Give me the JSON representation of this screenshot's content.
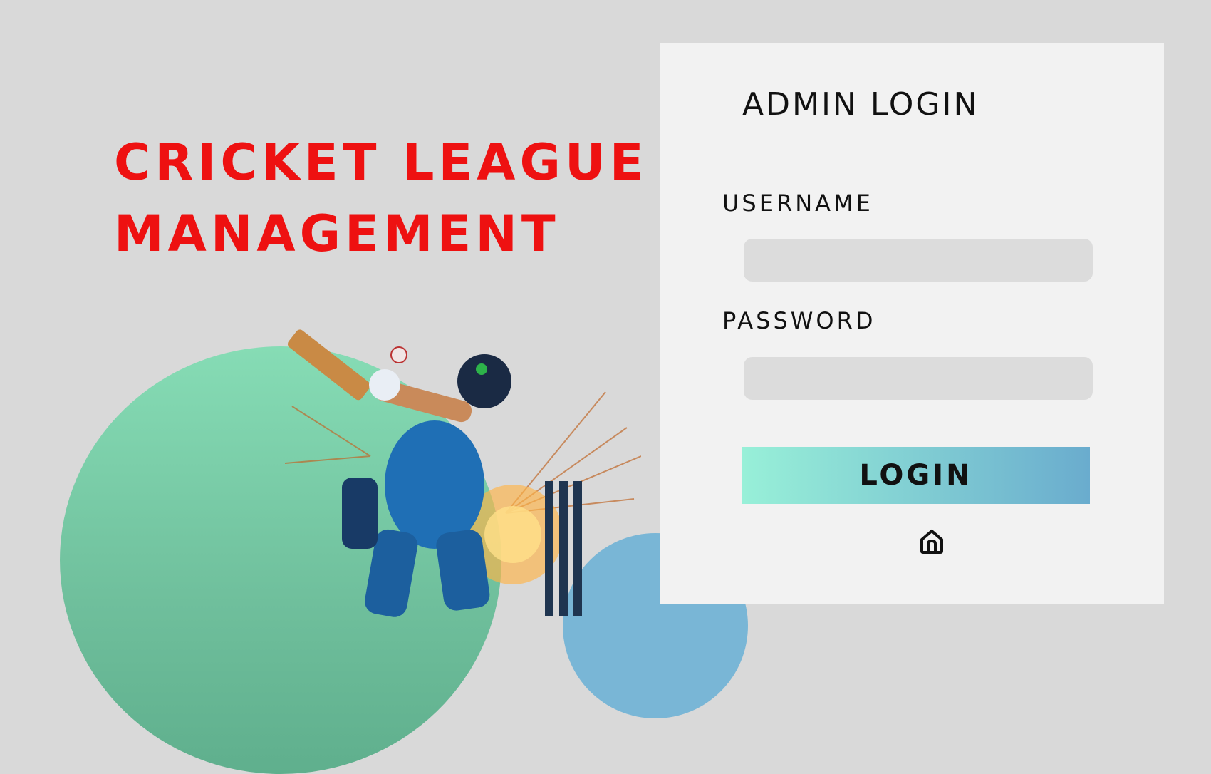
{
  "hero": {
    "title_line1": "CRICKET LEAGUE",
    "title_line2": "MANAGEMENT",
    "title_color": "#ee1111",
    "image": "cricket-batsman-illustration"
  },
  "login": {
    "title": "ADMIN LOGIN",
    "username_label": "USERNAME",
    "username_value": "",
    "password_label": "PASSWORD",
    "password_value": "",
    "button_label": "LOGIN",
    "home_icon": "home-icon"
  },
  "colors": {
    "background": "#d9d9d9",
    "panel": "#f2f2f2",
    "input_bg": "#dcdcdc",
    "button_gradient_start": "#98f0d8",
    "button_gradient_end": "#6aacce",
    "blob_green": "#86dcb5",
    "blob_blue": "#79b6d6"
  }
}
